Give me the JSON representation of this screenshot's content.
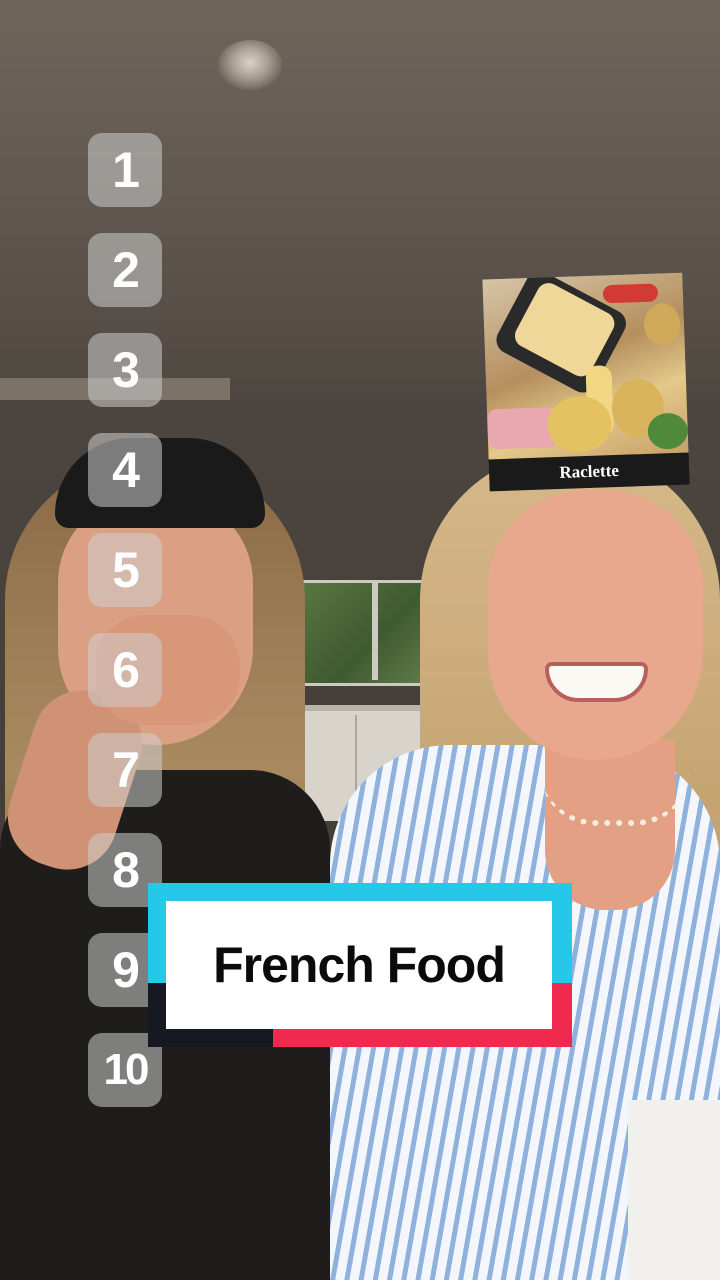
{
  "overlay": {
    "numbers": [
      "1",
      "2",
      "3",
      "4",
      "5",
      "6",
      "7",
      "8",
      "9",
      "10"
    ],
    "food_card": {
      "label": "Raclette"
    },
    "title_banner": {
      "text": "French Food",
      "colors": {
        "cyan": "#25c8e8",
        "red": "#f0294f",
        "dark": "#161922",
        "fill": "#ffffff"
      }
    }
  }
}
